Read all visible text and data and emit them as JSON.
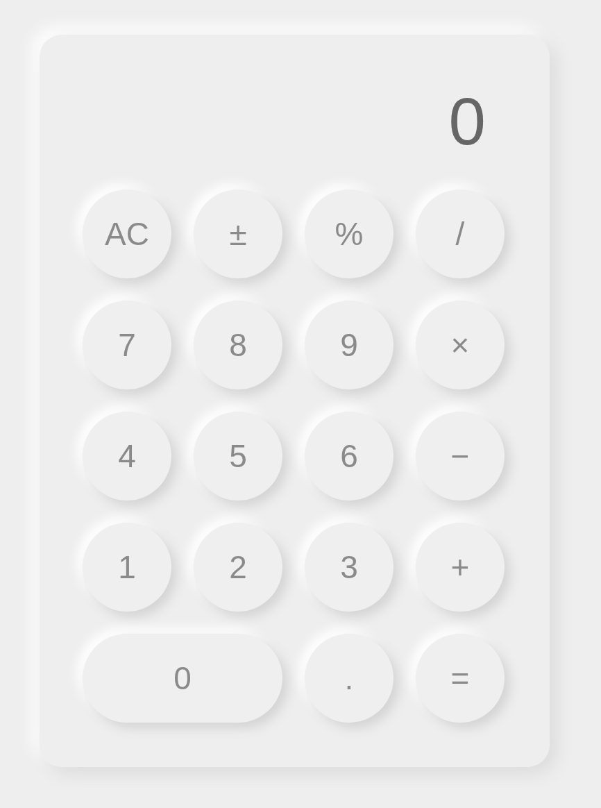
{
  "display": {
    "value": "0"
  },
  "keys": [
    {
      "label": "AC",
      "kind": "round"
    },
    {
      "label": "±",
      "kind": "round"
    },
    {
      "label": "%",
      "kind": "round"
    },
    {
      "label": "/",
      "kind": "round"
    },
    {
      "label": "7",
      "kind": "round"
    },
    {
      "label": "8",
      "kind": "round"
    },
    {
      "label": "9",
      "kind": "round"
    },
    {
      "label": "×",
      "kind": "round"
    },
    {
      "label": "4",
      "kind": "round"
    },
    {
      "label": "5",
      "kind": "round"
    },
    {
      "label": "6",
      "kind": "round"
    },
    {
      "label": "−",
      "kind": "round"
    },
    {
      "label": "1",
      "kind": "round"
    },
    {
      "label": "2",
      "kind": "round"
    },
    {
      "label": "3",
      "kind": "round"
    },
    {
      "label": "+",
      "kind": "round"
    },
    {
      "label": "0",
      "kind": "wide"
    },
    {
      "label": ".",
      "kind": "round"
    },
    {
      "label": "=",
      "kind": "round"
    }
  ]
}
